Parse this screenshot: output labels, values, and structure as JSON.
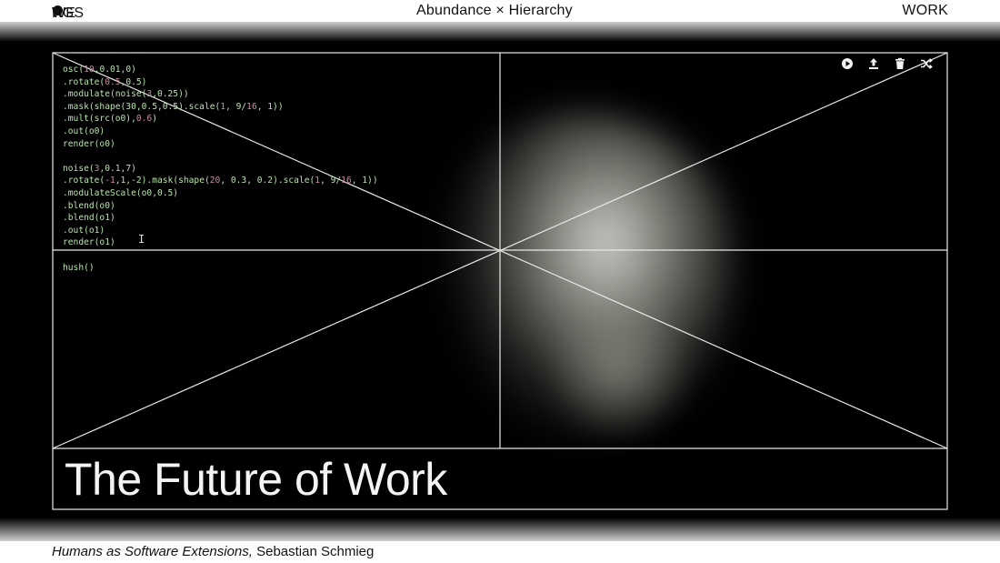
{
  "header": {
    "brand_part1": "WE ARE ALL CYB",
    "brand_part2": "RGS",
    "center_title": "Abundance × Hierarchy",
    "nav_work": "WORK"
  },
  "code_lines": [
    [
      [
        "osc(",
        ""
      ],
      [
        "10",
        "num"
      ],
      [
        ",0.01,0)",
        ""
      ]
    ],
    [
      [
        ".rotate(",
        ""
      ],
      [
        "0.5",
        "num"
      ],
      [
        ",0.5)",
        ""
      ]
    ],
    [
      [
        ".modulate(noise(",
        ""
      ],
      [
        "3",
        "num"
      ],
      [
        ",0.25))",
        ""
      ]
    ],
    [
      [
        ".mask(shape(30,0.5,0.5).scale(",
        ""
      ],
      [
        "1",
        "num"
      ],
      [
        ", 9/",
        ""
      ],
      [
        "16",
        "num"
      ],
      [
        ", 1))",
        ""
      ]
    ],
    [
      [
        ".mult(src(o0),",
        ""
      ],
      [
        "0.6",
        "num"
      ],
      [
        ")",
        ""
      ]
    ],
    [
      [
        ".out(o0)",
        ""
      ]
    ],
    [
      [
        "render(o0)",
        ""
      ]
    ],
    [
      [
        "",
        ""
      ]
    ],
    [
      [
        "noise(",
        ""
      ],
      [
        "3",
        "num"
      ],
      [
        ",0.1,7)",
        ""
      ]
    ],
    [
      [
        ".rotate(",
        ""
      ],
      [
        "-1",
        "num"
      ],
      [
        ",1,-2).mask(shape(",
        ""
      ],
      [
        "20",
        "num"
      ],
      [
        ", 0.3, 0.2).scale(",
        ""
      ],
      [
        "1",
        "num"
      ],
      [
        ", 9/",
        ""
      ],
      [
        "16",
        "num"
      ],
      [
        ", 1))",
        ""
      ]
    ],
    [
      [
        ".modulateScale(o0,0.5)",
        ""
      ]
    ],
    [
      [
        ".blend(o0)",
        ""
      ]
    ],
    [
      [
        ".blend(o1)",
        ""
      ]
    ],
    [
      [
        ".out(o1)",
        ""
      ]
    ],
    [
      [
        "render(o1)",
        ""
      ]
    ],
    [
      [
        "",
        ""
      ]
    ],
    [
      [
        "hush()",
        ""
      ]
    ]
  ],
  "toolbar": {
    "play_icon": "play-icon",
    "upload_icon": "upload-icon",
    "delete_icon": "trash-icon",
    "shuffle_icon": "shuffle-icon"
  },
  "headline": "The Future of Work",
  "caption": {
    "title": "Humans as Software Extensions,",
    "author": " Sebastian Schmieg"
  },
  "colors": {
    "code": "#b9e3ad",
    "code_number": "#c48d9a",
    "frame_lines": "#e8e8e8",
    "stage_bg": "#000000"
  }
}
